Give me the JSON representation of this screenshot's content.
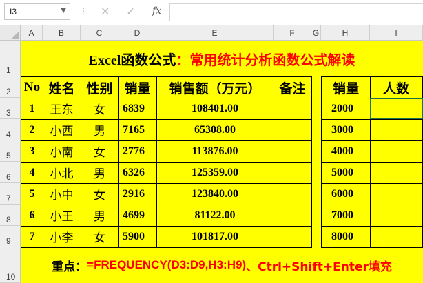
{
  "formula_bar": {
    "name_box": "I3",
    "cancel_icon": "✕",
    "enter_icon": "✓",
    "fx_label": "fx",
    "formula": ""
  },
  "columns": [
    "A",
    "B",
    "C",
    "D",
    "E",
    "F",
    "G",
    "H",
    "I"
  ],
  "rows": [
    "1",
    "2",
    "3",
    "4",
    "5",
    "6",
    "7",
    "8",
    "9",
    "10"
  ],
  "title": {
    "part1": "Excel函数公式",
    "part2": "：常用统计分析函数公式解读"
  },
  "table": {
    "headers": [
      "No",
      "姓名",
      "性别",
      "销量",
      "销售额（万元）",
      "备注"
    ],
    "rows": [
      {
        "no": "1",
        "name": "王东",
        "gender": "女",
        "sales": "6839",
        "amount": "108401.00",
        "note": ""
      },
      {
        "no": "2",
        "name": "小西",
        "gender": "男",
        "sales": "7165",
        "amount": "65308.00",
        "note": ""
      },
      {
        "no": "3",
        "name": "小南",
        "gender": "女",
        "sales": "2776",
        "amount": "113876.00",
        "note": ""
      },
      {
        "no": "4",
        "name": "小北",
        "gender": "男",
        "sales": "6326",
        "amount": "125359.00",
        "note": ""
      },
      {
        "no": "5",
        "name": "小中",
        "gender": "女",
        "sales": "2916",
        "amount": "123840.00",
        "note": ""
      },
      {
        "no": "6",
        "name": "小王",
        "gender": "男",
        "sales": "4699",
        "amount": "81122.00",
        "note": ""
      },
      {
        "no": "7",
        "name": "小李",
        "gender": "女",
        "sales": "5900",
        "amount": "101817.00",
        "note": ""
      }
    ]
  },
  "bins": {
    "headers": [
      "销量",
      "人数"
    ],
    "values": [
      "2000",
      "3000",
      "4000",
      "5000",
      "6000",
      "7000",
      "8000"
    ]
  },
  "note": {
    "label": "重点：",
    "formula": "=FREQUENCY(D3:D9,H3:H9)",
    "suffix": "、Ctrl+Shift+Enter填充"
  },
  "colors": {
    "highlight": "#ffff00",
    "accent_red": "#ff0000",
    "text": "#000000"
  }
}
